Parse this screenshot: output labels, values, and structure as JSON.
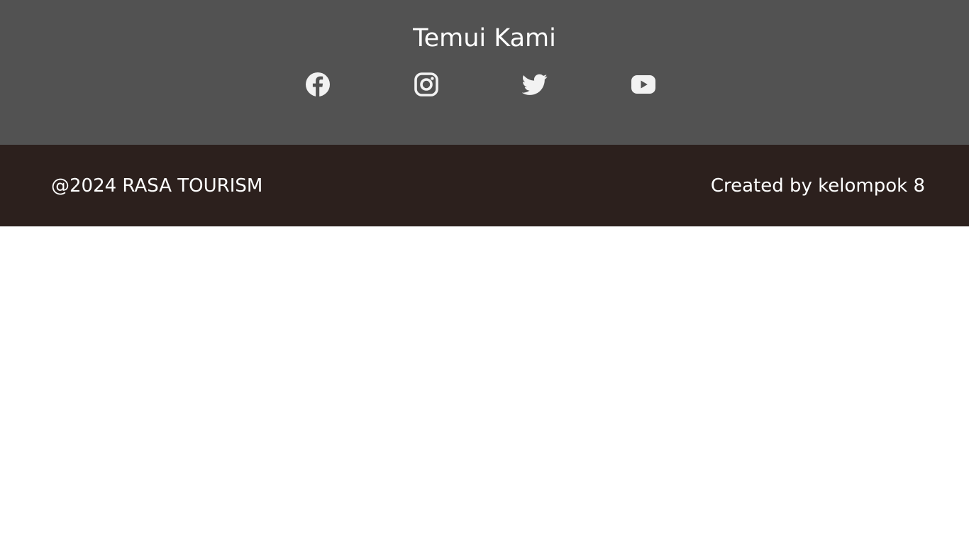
{
  "contact": {
    "title": "Temui Kami",
    "social": [
      {
        "name": "facebook",
        "icon": "facebook-icon"
      },
      {
        "name": "instagram",
        "icon": "instagram-icon"
      },
      {
        "name": "twitter",
        "icon": "twitter-icon"
      },
      {
        "name": "youtube",
        "icon": "youtube-icon"
      }
    ]
  },
  "footer": {
    "copyright": "@2024 RASA TOURISM",
    "credits": "Created by kelompok 8"
  },
  "colors": {
    "contact_background": "#525252",
    "footer_background": "#2c201d",
    "text": "#ffffff",
    "page_background": "#ffffff"
  }
}
